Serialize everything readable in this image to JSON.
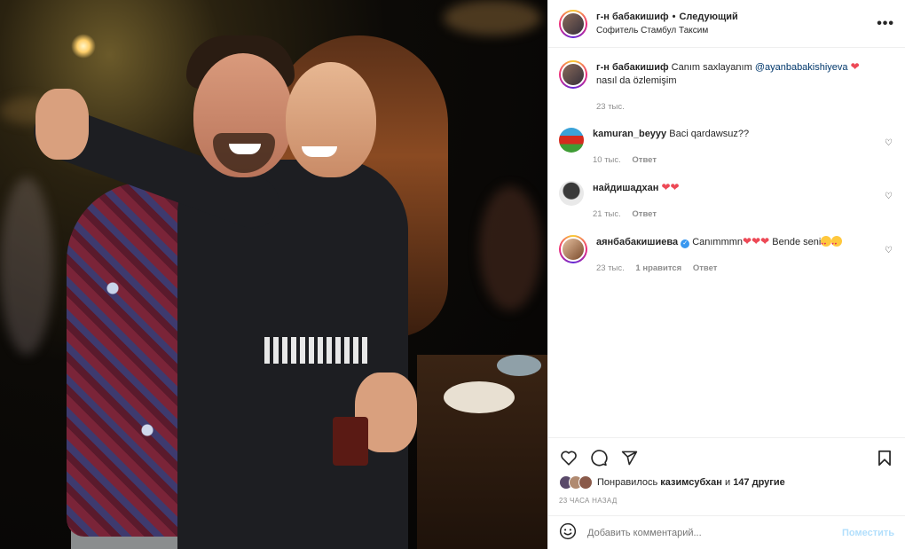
{
  "post": {
    "author": "г-н бабакишиф",
    "follow_label": "Следующий",
    "location": "Софитель Стамбул Таксим",
    "more_label": "•••"
  },
  "caption": {
    "author": "г-н бабакишиф",
    "text_before": "Canım saxlayanım",
    "mention": "@ayanbabakishiyeva",
    "heart": "❤",
    "text_after": "nasıl da özlemişim",
    "time": "23 тыс."
  },
  "comments": [
    {
      "author": "kamuran_beyyy",
      "text": "Baci qardawsuz??",
      "time": "10 тыс.",
      "likes": "",
      "reply_label": "Ответ",
      "avatar_color": "#3aa2d8"
    },
    {
      "author": "найдишадхан",
      "text": "❤❤",
      "time": "21 тыс.",
      "likes": "",
      "reply_label": "Ответ",
      "avatar_color": "#e9e9e9"
    },
    {
      "author": "аянбабакишиева",
      "verified": "✓",
      "text_before": "Canımmmn",
      "hearts": "❤❤❤",
      "text_after": "Bende seni",
      "time": "23 тыс.",
      "likes": "1 нравится",
      "reply_label": "Ответ",
      "avatar_color": "#c99a78"
    }
  ],
  "icons": {
    "like": "heart-icon",
    "comment": "comment-icon",
    "share": "share-icon",
    "save": "bookmark-icon"
  },
  "likes_text": {
    "prefix": "Понравилось",
    "user": "казимсубхан",
    "mid": "и",
    "rest": "147 другие"
  },
  "timestamp": "23 ЧАСА НАЗАД",
  "add_comment": {
    "placeholder": "Добавить комментарий...",
    "post_label": "Поместить"
  },
  "colors": {
    "accent_link": "#00376b",
    "heart": "#ed4956",
    "post_disabled": "#b2dffc",
    "meta_gray": "#8e8e8e"
  }
}
